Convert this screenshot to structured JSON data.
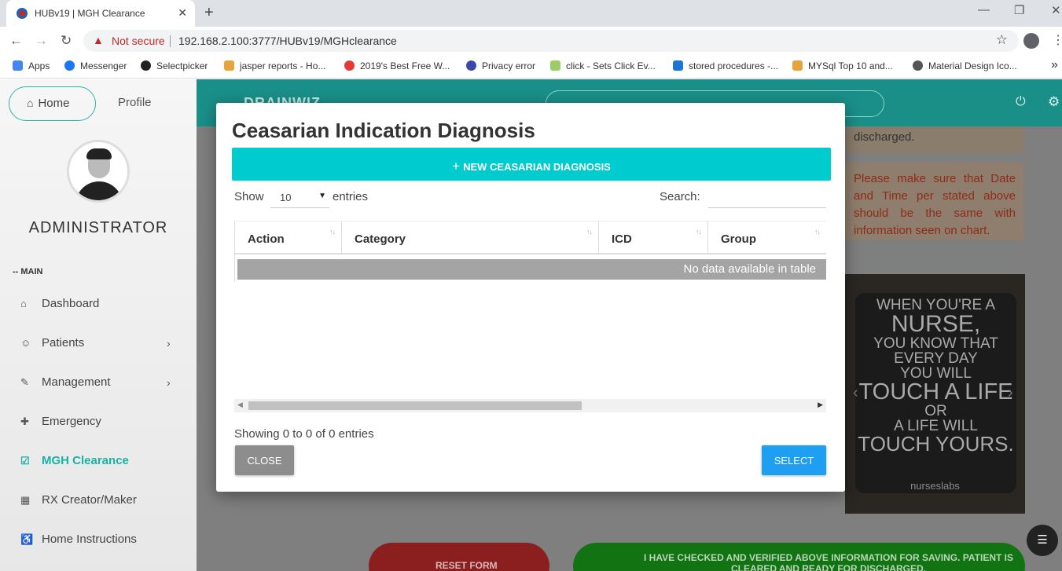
{
  "browser": {
    "tab_title": "HUBv19 | MGH Clearance",
    "tab_close": "✕",
    "new_tab": "+",
    "warning_icon": "▲",
    "security_label": "Not secure",
    "url": "192.168.2.100:3777/HUBv19/MGHclearance",
    "bookmarks": [
      {
        "label": "Apps",
        "color": "#4285f4"
      },
      {
        "label": "Messenger",
        "color": "#1877f2"
      },
      {
        "label": "Selectpicker",
        "color": "#222222"
      },
      {
        "label": "jasper reports - Ho...",
        "color": "#e8a33b"
      },
      {
        "label": "2019's Best Free W...",
        "color": "#e53935"
      },
      {
        "label": "Privacy error",
        "color": "#3949ab"
      },
      {
        "label": "click - Sets Click Ev...",
        "color": "#9ccc65"
      },
      {
        "label": "stored procedures -...",
        "color": "#1976d2"
      },
      {
        "label": "MYSql Top 10 and...",
        "color": "#e8a33b"
      },
      {
        "label": "Material Design Ico...",
        "color": "#555555"
      }
    ],
    "bookmarks_overflow": "»"
  },
  "sidebar": {
    "home": "Home",
    "profile": "Profile",
    "user_name": "ADMINISTRATOR",
    "section_label": "-- MAIN",
    "items": [
      {
        "label": "Dashboard",
        "icon": "⌂"
      },
      {
        "label": "Patients",
        "icon": "☺",
        "arrow": "›"
      },
      {
        "label": "Management",
        "icon": "✎",
        "arrow": "›"
      },
      {
        "label": "Emergency",
        "icon": "✚"
      },
      {
        "label": "MGH Clearance",
        "icon": "☑"
      },
      {
        "label": "RX Creator/Maker",
        "icon": "▦"
      },
      {
        "label": "Home Instructions",
        "icon": "♿"
      }
    ]
  },
  "header": {
    "brand": "DRAINWIZ",
    "power_icon": "⏻",
    "settings_icon": "⚙"
  },
  "background_content": {
    "card1_text": "discharged.",
    "card2_text": "Please make sure that Date and Time per stated above should be the same with information seen on chart.",
    "poster_lines": [
      "WHEN YOU'RE A",
      "NURSE,",
      "YOU KNOW THAT",
      "EVERY DAY",
      "YOU WILL",
      "TOUCH A LIFE",
      "OR",
      "A LIFE WILL",
      "TOUCH YOURS."
    ],
    "poster_brand": "nurseslabs",
    "reset_label": "RESET FORM",
    "verify_label": "I HAVE CHECKED AND VERIFIED ABOVE INFORMATION FOR SAVING. PATIENT IS CLEARED AND READY FOR DISCHARGED."
  },
  "modal": {
    "title": "Ceasarian Indication Diagnosis",
    "new_button": "NEW CEASARIAN DIAGNOSIS",
    "new_button_icon": "+",
    "show_label": "Show",
    "entries_value": "10",
    "entries_label": "entries",
    "search_label": "Search:",
    "search_value": "",
    "columns": [
      "Action",
      "Category",
      "ICD",
      "Group"
    ],
    "empty_message": "No data available in table",
    "info": "Showing 0 to 0 of 0 entries",
    "close_button": "CLOSE",
    "select_button": "SELECT"
  }
}
